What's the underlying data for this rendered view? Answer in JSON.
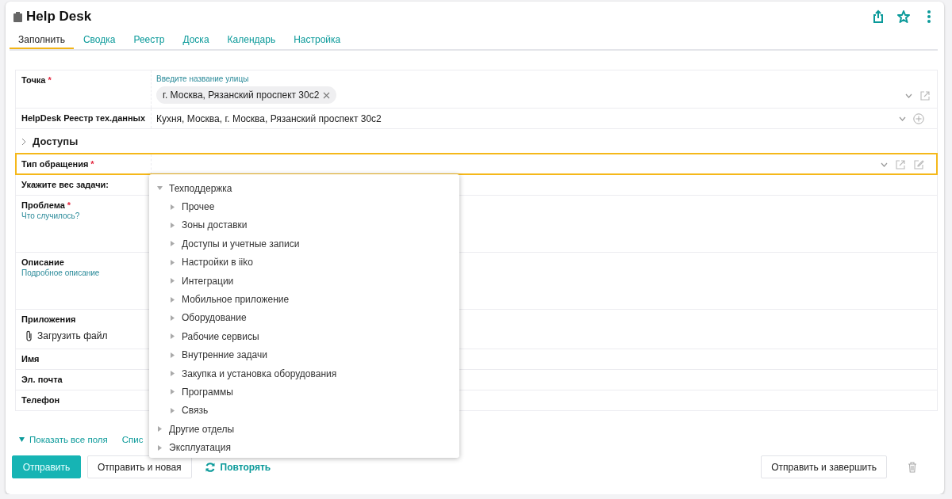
{
  "header": {
    "title": "Help Desk"
  },
  "tabs": [
    {
      "label": "Заполнить",
      "selected": true
    },
    {
      "label": "Сводка",
      "selected": false
    },
    {
      "label": "Реестр",
      "selected": false
    },
    {
      "label": "Доска",
      "selected": false
    },
    {
      "label": "Календарь",
      "selected": false
    },
    {
      "label": "Настройка",
      "selected": false
    }
  ],
  "fields": [
    {
      "kind": "chips",
      "label": "Точка",
      "required_mark": "*",
      "hint": "Введите название улицы",
      "chips": [
        "г. Москва, Рязанский проспект 30с2"
      ]
    },
    {
      "kind": "reference",
      "label": "HelpDesk Реестр тех.данных",
      "value": "Кухня, Москва, г. Москва, Рязанский проспект 30с2"
    },
    {
      "kind": "section",
      "label": "Доступы",
      "expanded": false
    },
    {
      "kind": "select",
      "label": "Тип обращения",
      "required_mark": "*",
      "focused": true
    },
    {
      "kind": "plain",
      "label": "Укажите вес задачи:"
    },
    {
      "kind": "textarea",
      "label": "Проблема",
      "required_mark": "*",
      "hint": "Что случилось?"
    },
    {
      "kind": "textarea",
      "label": "Описание",
      "hint": "Подробное описание"
    },
    {
      "kind": "upload",
      "label": "Приложения",
      "action": "Загрузить файл"
    },
    {
      "kind": "plain",
      "label": "Имя"
    },
    {
      "kind": "plain",
      "label": "Эл. почта"
    },
    {
      "kind": "plain",
      "label": "Телефон"
    }
  ],
  "dropdown": {
    "tree": [
      {
        "label": "Техподдержка",
        "expanded": true,
        "children": [
          {
            "label": "Прочее",
            "expanded": false
          },
          {
            "label": "Зоны доставки",
            "expanded": false
          },
          {
            "label": "Доступы и учетные записи",
            "expanded": false
          },
          {
            "label": "Настройки в iiko",
            "expanded": false
          },
          {
            "label": "Интеграции",
            "expanded": false
          },
          {
            "label": "Мобильное приложение",
            "expanded": false
          },
          {
            "label": "Оборудование",
            "expanded": false
          },
          {
            "label": "Рабочие сервисы",
            "expanded": false
          },
          {
            "label": "Внутренние задачи",
            "expanded": false
          },
          {
            "label": "Закупка и установка оборудования",
            "expanded": false
          },
          {
            "label": "Программы",
            "expanded": false
          },
          {
            "label": "Связь",
            "expanded": false
          }
        ]
      },
      {
        "label": "Другие отделы",
        "expanded": false
      },
      {
        "label": "Эксплуатация",
        "expanded": false
      }
    ]
  },
  "footer_links": [
    {
      "label": "Показать все поля",
      "expanded": true
    },
    {
      "label": "Спис"
    }
  ],
  "buttons": [
    {
      "label": "Отправить",
      "kind": "primary"
    },
    {
      "label": "Отправить и новая",
      "kind": "secondary"
    },
    {
      "label": "Повторять",
      "kind": "repeat"
    }
  ],
  "right_buttons": [
    {
      "label": "Отправить и завершить",
      "kind": "secondary"
    },
    {
      "kind": "delete"
    }
  ]
}
